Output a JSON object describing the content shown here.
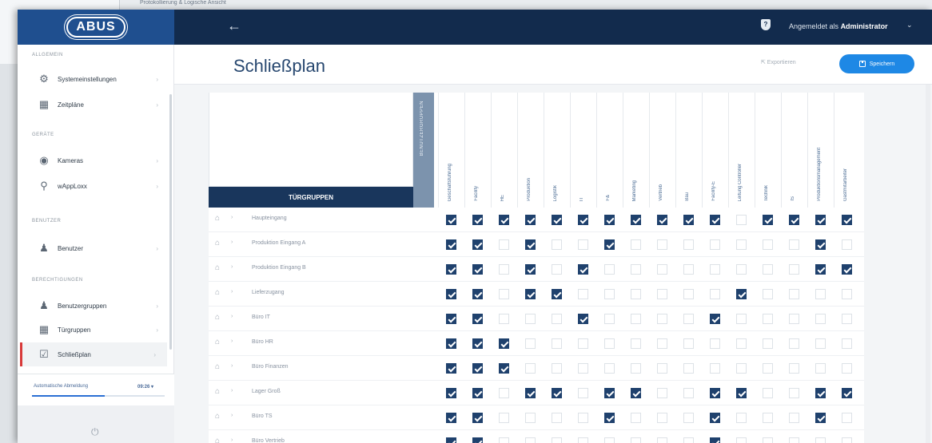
{
  "background": {
    "tab_text": "Protokollierung & Logische Ansicht"
  },
  "topbar": {
    "logo_text": "ABUS",
    "back_icon": "arrow-left-icon",
    "user_prefix": "Angemeldet als",
    "user_name": "Administrator"
  },
  "sidebar": {
    "sections": [
      {
        "label": "Allgemein",
        "items": [
          {
            "label": "Systemeinstellungen",
            "icon": "gear-icon"
          },
          {
            "label": "Zeitpläne",
            "icon": "calendar-icon"
          }
        ]
      },
      {
        "label": "Geräte",
        "items": [
          {
            "label": "Kameras",
            "icon": "camera-icon"
          },
          {
            "label": "wAppLoxx",
            "icon": "key-icon"
          }
        ]
      },
      {
        "label": "Benutzer",
        "items": [
          {
            "label": "Benutzer",
            "icon": "user-icon"
          }
        ]
      },
      {
        "label": "Berechtigungen",
        "items": [
          {
            "label": "Benutzergruppen",
            "icon": "users-icon"
          },
          {
            "label": "Türgruppen",
            "icon": "door-grid-icon"
          },
          {
            "label": "Schließplan",
            "icon": "checkbox-icon",
            "active": true
          }
        ]
      }
    ],
    "auto_logout": {
      "label": "Automatische Abmeldung",
      "value": "09:26 ▾",
      "progress": 0.55
    }
  },
  "header": {
    "title": "Schließplan",
    "export_label": "⇱ Exportieren",
    "save_label": "Speichern"
  },
  "matrix": {
    "door_groups_label": "TÜRGRUPPEN",
    "user_groups_label": "BENUTZERGRUPPEN",
    "columns": [
      "Geschäftsführung",
      "Facility",
      "HE",
      "Produktion",
      "Logistik",
      "IT",
      "F&",
      "Marketing",
      "Vertrieb",
      "Bau",
      "Facility-E",
      "Leitung Controller",
      "Technik",
      "IS",
      "Produktionsmanagement",
      "Gastmitarbeiter"
    ],
    "rows": [
      {
        "name": "Haupteingang",
        "checks": [
          1,
          1,
          1,
          1,
          1,
          1,
          1,
          1,
          1,
          1,
          1,
          0,
          1,
          1,
          1,
          1
        ]
      },
      {
        "name": "Produktion Eingang A",
        "checks": [
          1,
          1,
          0,
          1,
          0,
          0,
          1,
          0,
          0,
          0,
          0,
          0,
          0,
          0,
          1,
          0
        ]
      },
      {
        "name": "Produktion Eingang B",
        "checks": [
          1,
          1,
          0,
          1,
          0,
          1,
          0,
          0,
          0,
          0,
          0,
          0,
          0,
          0,
          1,
          1
        ]
      },
      {
        "name": "Lieferzugang",
        "checks": [
          1,
          1,
          0,
          1,
          1,
          0,
          0,
          0,
          0,
          0,
          0,
          1,
          0,
          0,
          0,
          0
        ]
      },
      {
        "name": "Büro IT",
        "checks": [
          1,
          1,
          0,
          0,
          0,
          1,
          0,
          0,
          0,
          0,
          1,
          0,
          0,
          0,
          0,
          0
        ]
      },
      {
        "name": "Büro HR",
        "checks": [
          1,
          1,
          1,
          0,
          0,
          0,
          0,
          0,
          0,
          0,
          0,
          0,
          0,
          0,
          0,
          0
        ]
      },
      {
        "name": "Büro Finanzen",
        "checks": [
          1,
          1,
          1,
          0,
          0,
          0,
          0,
          0,
          0,
          0,
          0,
          0,
          0,
          0,
          0,
          0
        ]
      },
      {
        "name": "Lager Groß",
        "checks": [
          1,
          1,
          0,
          1,
          1,
          0,
          1,
          1,
          0,
          0,
          1,
          1,
          0,
          0,
          1,
          1
        ]
      },
      {
        "name": "Büro TS",
        "checks": [
          1,
          1,
          0,
          0,
          0,
          0,
          1,
          0,
          0,
          0,
          1,
          0,
          0,
          0,
          1,
          0
        ]
      },
      {
        "name": "Büro Vertrieb",
        "checks": [
          1,
          1,
          0,
          0,
          0,
          0,
          0,
          0,
          0,
          0,
          1,
          0,
          0,
          0,
          0,
          0
        ]
      }
    ]
  },
  "colors": {
    "navy": "#122b4d",
    "accent": "#1e88e5",
    "active_marker": "#d83a3a",
    "check_on": "#1f416d"
  }
}
